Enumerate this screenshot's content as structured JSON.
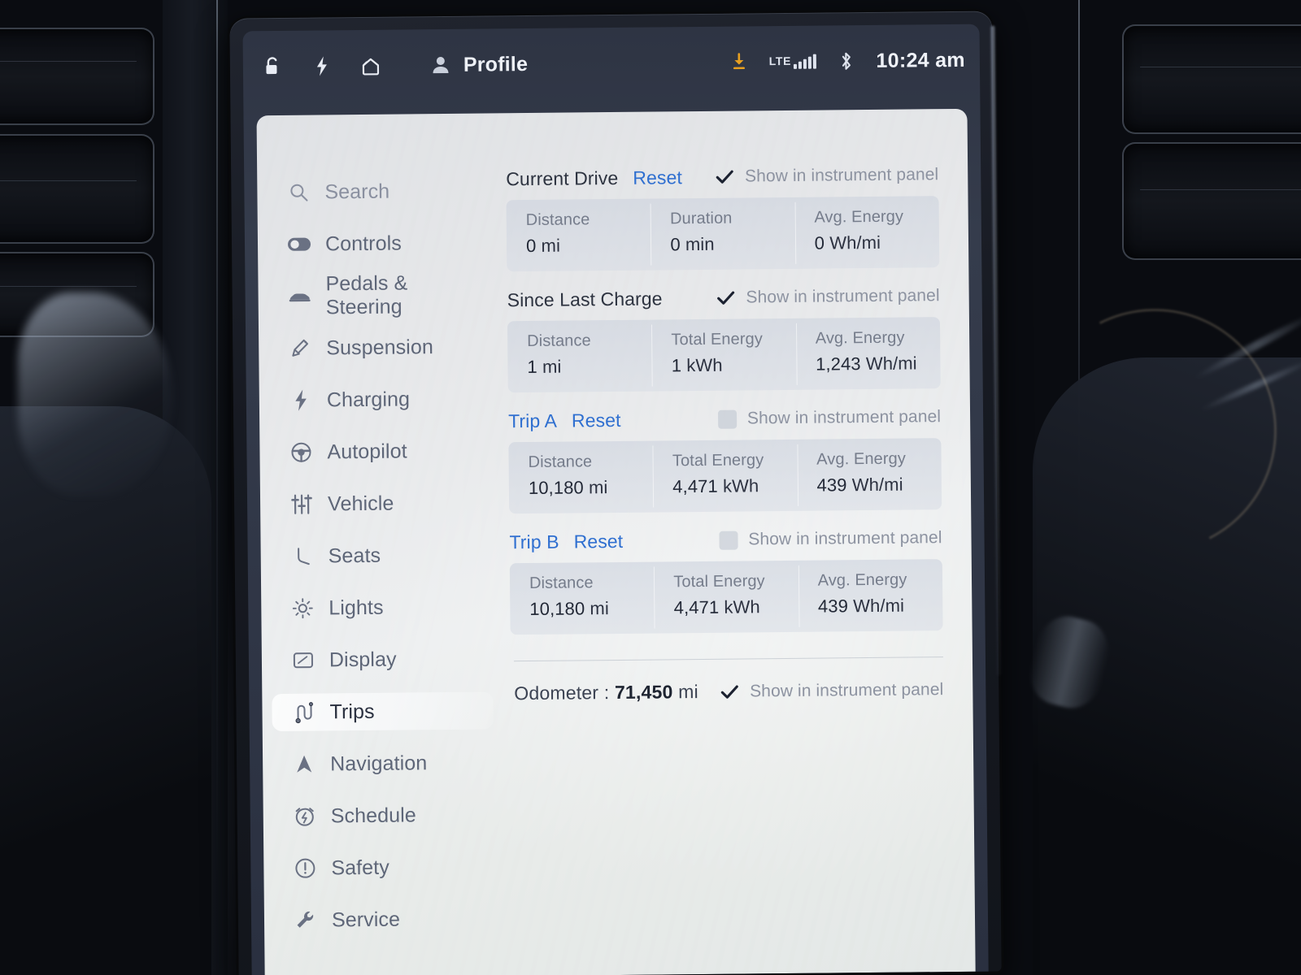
{
  "statusbar": {
    "icons": [
      "unlock-icon",
      "bolt-icon",
      "home-icon"
    ],
    "profile_label": "Profile",
    "download_icon": "download-icon",
    "network_label": "LTE",
    "bluetooth_icon": "bluetooth-icon",
    "clock": "10:24 am"
  },
  "sidebar": {
    "items": [
      {
        "label": "Search",
        "icon": "search-icon",
        "active": false,
        "muted": true
      },
      {
        "label": "Controls",
        "icon": "toggle-icon",
        "active": false,
        "muted": false
      },
      {
        "label": "Pedals & Steering",
        "icon": "car-icon",
        "active": false,
        "muted": false
      },
      {
        "label": "Suspension",
        "icon": "suspension-icon",
        "active": false,
        "muted": false
      },
      {
        "label": "Charging",
        "icon": "bolt-icon",
        "active": false,
        "muted": false
      },
      {
        "label": "Autopilot",
        "icon": "steering-icon",
        "active": false,
        "muted": false
      },
      {
        "label": "Vehicle",
        "icon": "sliders-icon",
        "active": false,
        "muted": false
      },
      {
        "label": "Seats",
        "icon": "seat-icon",
        "active": false,
        "muted": false
      },
      {
        "label": "Lights",
        "icon": "light-icon",
        "active": false,
        "muted": false
      },
      {
        "label": "Display",
        "icon": "display-icon",
        "active": false,
        "muted": false
      },
      {
        "label": "Trips",
        "icon": "trips-icon",
        "active": true,
        "muted": false
      },
      {
        "label": "Navigation",
        "icon": "navigation-icon",
        "active": false,
        "muted": false
      },
      {
        "label": "Schedule",
        "icon": "schedule-icon",
        "active": false,
        "muted": false
      },
      {
        "label": "Safety",
        "icon": "safety-icon",
        "active": false,
        "muted": false
      },
      {
        "label": "Service",
        "icon": "wrench-icon",
        "active": false,
        "muted": false
      }
    ]
  },
  "main": {
    "show_in_panel_label": "Show in instrument panel",
    "reset_label": "Reset",
    "blocks": [
      {
        "title": "Current Drive",
        "title_is_link": false,
        "has_reset": true,
        "show_in_panel": true,
        "stats": [
          {
            "label": "Distance",
            "value": "0",
            "unit": "mi"
          },
          {
            "label": "Duration",
            "value": "0",
            "unit": "min"
          },
          {
            "label": "Avg. Energy",
            "value": "0",
            "unit": "Wh/mi"
          }
        ]
      },
      {
        "title": "Since Last Charge",
        "title_is_link": false,
        "has_reset": false,
        "show_in_panel": true,
        "stats": [
          {
            "label": "Distance",
            "value": "1",
            "unit": "mi"
          },
          {
            "label": "Total Energy",
            "value": "1",
            "unit": "kWh"
          },
          {
            "label": "Avg. Energy",
            "value": "1,243",
            "unit": "Wh/mi"
          }
        ]
      },
      {
        "title": "Trip A",
        "title_is_link": true,
        "has_reset": true,
        "show_in_panel": false,
        "stats": [
          {
            "label": "Distance",
            "value": "10,180",
            "unit": "mi"
          },
          {
            "label": "Total Energy",
            "value": "4,471",
            "unit": "kWh"
          },
          {
            "label": "Avg. Energy",
            "value": "439",
            "unit": "Wh/mi"
          }
        ]
      },
      {
        "title": "Trip B",
        "title_is_link": true,
        "has_reset": true,
        "show_in_panel": false,
        "stats": [
          {
            "label": "Distance",
            "value": "10,180",
            "unit": "mi"
          },
          {
            "label": "Total Energy",
            "value": "4,471",
            "unit": "kWh"
          },
          {
            "label": "Avg. Energy",
            "value": "439",
            "unit": "Wh/mi"
          }
        ]
      }
    ],
    "odometer": {
      "label": "Odometer",
      "separator": ":",
      "value": "71,450",
      "unit": "mi",
      "show_in_panel": true
    }
  },
  "colors": {
    "link": "#2f6fd0",
    "download_accent": "#e8a020",
    "statusbar_bg": "#333a4a",
    "panel_bg": "#e8eaea"
  }
}
